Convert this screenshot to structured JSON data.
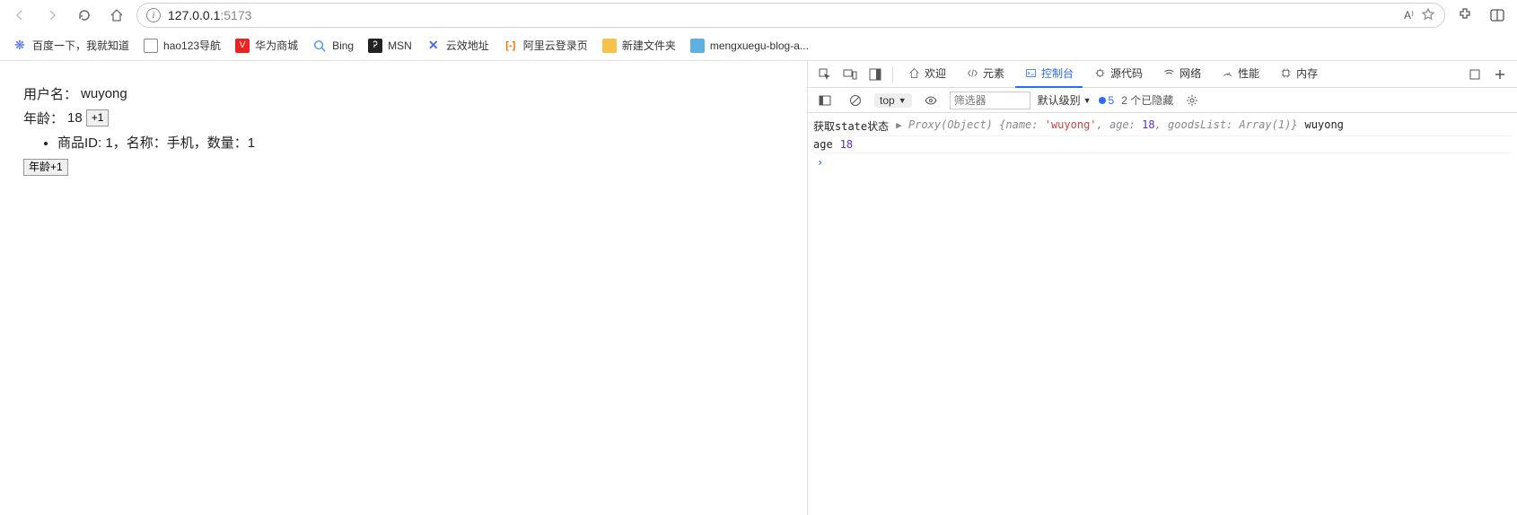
{
  "browser": {
    "url_main": "127.0.0.1",
    "url_port": ":5173"
  },
  "bookmarks": [
    {
      "label": "百度一下，我就知道",
      "icon": "baidu"
    },
    {
      "label": "hao123导航",
      "icon": "page"
    },
    {
      "label": "华为商城",
      "icon": "huawei"
    },
    {
      "label": "Bing",
      "icon": "bing"
    },
    {
      "label": "MSN",
      "icon": "msn"
    },
    {
      "label": "云效地址",
      "icon": "yunxiao"
    },
    {
      "label": "阿里云登录页",
      "icon": "ali"
    },
    {
      "label": "新建文件夹",
      "icon": "folder"
    },
    {
      "label": "mengxuegu-blog-a...",
      "icon": "blog"
    }
  ],
  "page": {
    "user_label": "用户名：",
    "user_value": "wuyong",
    "age_label": "年龄：",
    "age_value": "18",
    "plus1_btn": "+1",
    "goods_prefix": "商品ID:",
    "goods_id": "1",
    "goods_name_label": "，名称：",
    "goods_name": "手机",
    "goods_qty_label": "，数量：",
    "goods_qty": "1",
    "age_plus_btn": "年龄+1"
  },
  "devtools": {
    "tabs": {
      "welcome": "欢迎",
      "elements": "元素",
      "console": "控制台",
      "sources": "源代码",
      "network": "网络",
      "performance": "性能",
      "memory": "内存"
    },
    "toolbar": {
      "top": "top",
      "filter_placeholder": "筛选器",
      "level": "默认级别",
      "issue_count": "5",
      "hidden_text": "2 个已隐藏"
    },
    "console": {
      "line1_label": "获取state状态",
      "line1_proxy": "Proxy(Object)",
      "line1_obj_open": "{name:",
      "line1_name_val": "'wuyong'",
      "line1_age_key": ", age:",
      "line1_age_val": "18",
      "line1_goods_key": ", goodsList:",
      "line1_goods_val": "Array(1)",
      "line1_obj_close": "}",
      "line1_tail": "wuyong",
      "line2_label": "age",
      "line2_val": "18"
    }
  }
}
